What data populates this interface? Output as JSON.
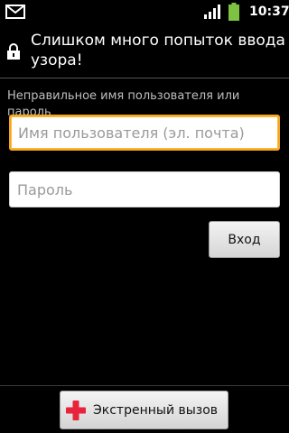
{
  "status_bar": {
    "time": "10:37",
    "icons": [
      "mail-icon",
      "signal-icon",
      "battery-icon"
    ]
  },
  "header": {
    "icon": "lock-icon",
    "title": "Слишком много попыток ввода узора!"
  },
  "form": {
    "error_message": "Неправильное имя пользователя или пароль",
    "username_placeholder": "Имя пользователя (эл. почта)",
    "username_value": "",
    "password_placeholder": "Пароль",
    "password_value": "",
    "login_label": "Вход"
  },
  "footer": {
    "emergency_icon": "plus-icon",
    "emergency_label": "Экстренный вызов"
  },
  "colors": {
    "background": "#000000",
    "focus": "#f5a623",
    "emergency_plus": "#e8243c",
    "battery": "#7ec242"
  }
}
